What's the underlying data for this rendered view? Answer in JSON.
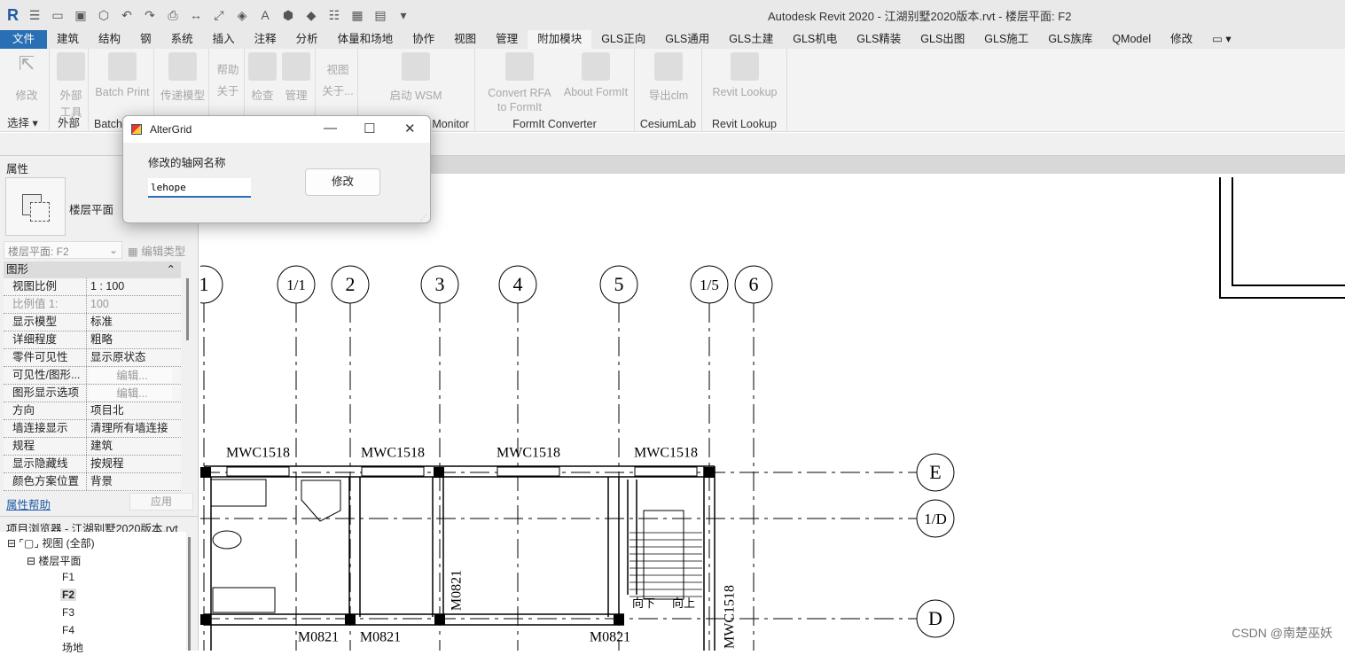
{
  "app": {
    "title": "Autodesk Revit 2020 - 江湖别墅2020版本.rvt - 楼层平面: F2",
    "logo": "R"
  },
  "tabs": [
    "文件",
    "建筑",
    "结构",
    "钢",
    "系统",
    "插入",
    "注释",
    "分析",
    "体量和场地",
    "协作",
    "视图",
    "管理",
    "附加模块",
    "GLS正向",
    "GLS通用",
    "GLS土建",
    "GLS机电",
    "GLS精装",
    "GLS出图",
    "GLS施工",
    "GLS族库",
    "QModel",
    "修改"
  ],
  "active_tab": "附加模块",
  "ribbon": {
    "buttons": [
      {
        "label": "修改",
        "panel": "选择 ▾"
      },
      {
        "label": "外部\n工具",
        "panel": "外部"
      },
      {
        "label": "Batch Print",
        "panel": "Batch"
      },
      {
        "label": "传递模型"
      },
      {
        "label": "帮助\n关于"
      },
      {
        "label": "检查"
      },
      {
        "label": "管理"
      },
      {
        "label": "视图\n关于..."
      },
      {
        "label": "启动 WSM",
        "panel": "Monitor"
      },
      {
        "label": "Convert RFA\nto FormIt"
      },
      {
        "label": "About FormIt",
        "panel": "FormIt Converter"
      },
      {
        "label": "导出clm",
        "panel": "CesiumLab"
      },
      {
        "label": "Revit Lookup",
        "panel": "Revit Lookup"
      }
    ]
  },
  "properties": {
    "header": "属性",
    "type_name": "楼层平面",
    "type_selector": "楼层平面: F2",
    "edit_type": "编辑类型",
    "group": "图形",
    "rows": [
      {
        "k": "视图比例",
        "v": "1 : 100"
      },
      {
        "k": "比例值 1:",
        "v": "100",
        "dim": true
      },
      {
        "k": "显示模型",
        "v": "标准"
      },
      {
        "k": "详细程度",
        "v": "粗略"
      },
      {
        "k": "零件可见性",
        "v": "显示原状态"
      },
      {
        "k": "可见性/图形...",
        "v": "编辑...",
        "btn": true
      },
      {
        "k": "图形显示选项",
        "v": "编辑...",
        "btn": true
      },
      {
        "k": "方向",
        "v": "项目北"
      },
      {
        "k": "墙连接显示",
        "v": "清理所有墙连接"
      },
      {
        "k": "规程",
        "v": "建筑"
      },
      {
        "k": "显示隐藏线",
        "v": "按规程"
      },
      {
        "k": "颜色方案位置",
        "v": "背景"
      }
    ],
    "help": "属性帮助",
    "apply": "应用"
  },
  "browser": {
    "title": "项目浏览器 - 江湖别墅2020版本.rvt",
    "root": "视图 (全部)",
    "group": "楼层平面",
    "items": [
      "F1",
      "F2",
      "F3",
      "F4",
      "场地"
    ],
    "selected": "F2"
  },
  "dialog": {
    "title": "AlterGrid",
    "label": "修改的轴网名称",
    "input_value": "lehope",
    "button": "修改"
  },
  "drawing": {
    "grids_v": [
      "1",
      "1/1",
      "2",
      "3",
      "4",
      "5",
      "1/5",
      "6"
    ],
    "grids_h": [
      "E",
      "1/D",
      "D"
    ],
    "windows": [
      "MWC1518",
      "MWC1518",
      "MWC1518",
      "MWC1518",
      "MWC1518"
    ],
    "doors": [
      "M0821",
      "M0821",
      "M0821",
      "M0821"
    ],
    "stair_labels": [
      "向下",
      "向上"
    ]
  },
  "watermark": "CSDN @南楚巫妖"
}
